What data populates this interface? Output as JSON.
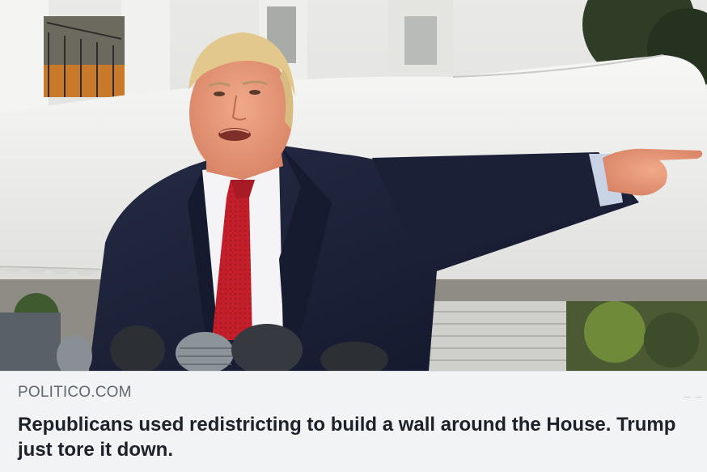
{
  "link_preview": {
    "image_alt": "Trump pointing while speaking to reporters outside the White House",
    "domain": "POLITICO.COM",
    "headline": "Republicans used redistricting to build a wall around the House. Trump just tore it down."
  },
  "colors": {
    "caption_background": "#f2f3f5",
    "domain_text": "#606770",
    "headline_text": "#1d2129",
    "coat": "#1a1f33",
    "tie": "#c21f2b"
  }
}
